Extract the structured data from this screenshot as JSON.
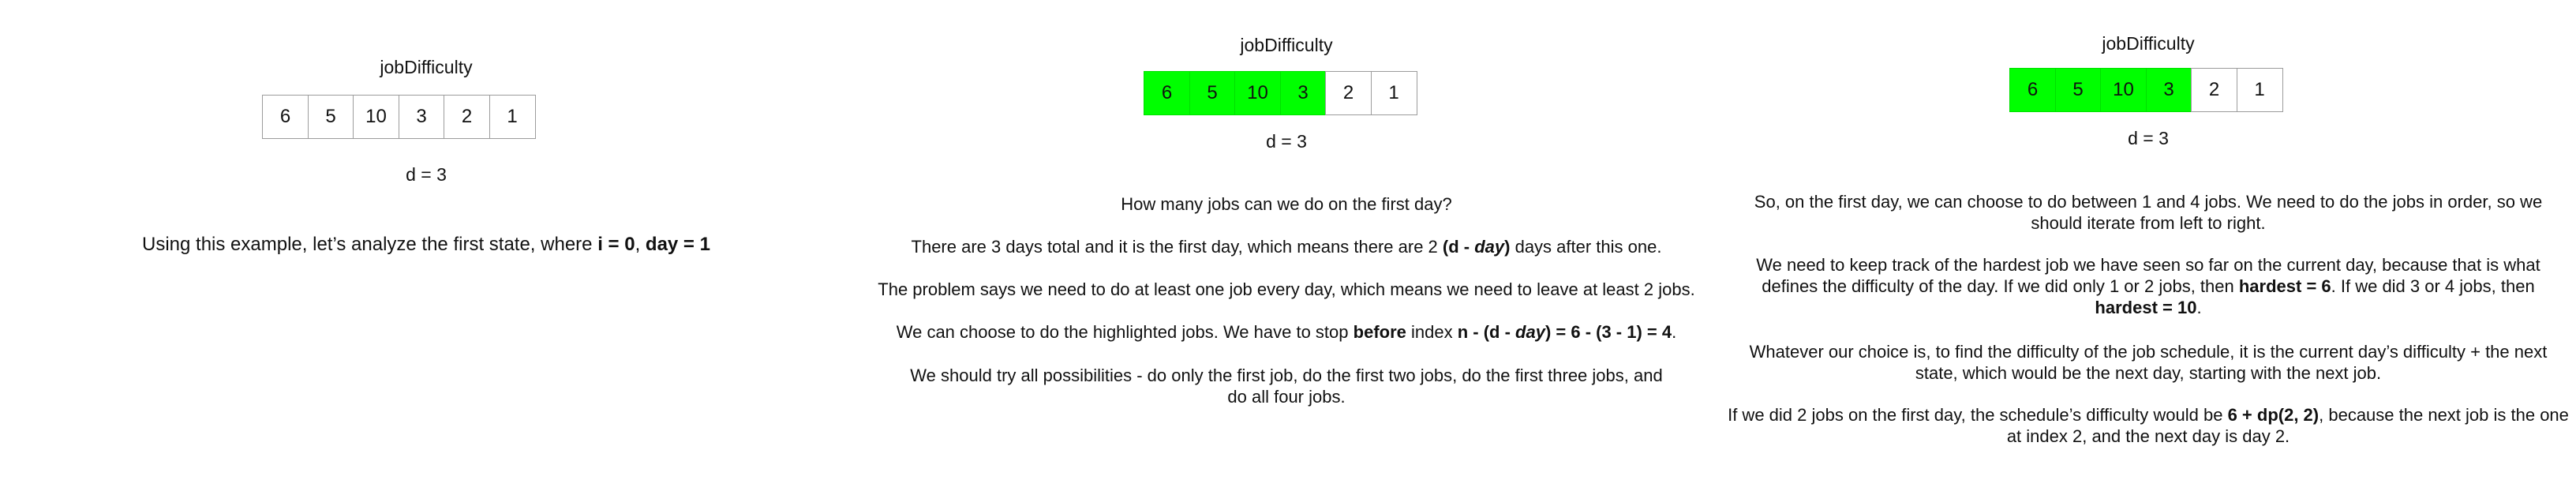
{
  "panel1": {
    "title": "jobDifficulty",
    "cells": [
      "6",
      "5",
      "10",
      "3",
      "2",
      "1"
    ],
    "d_label": "d = 3",
    "caption": {
      "pre": "Using this example, let’s analyze the first state, where ",
      "b1": "i = 0",
      "mid": ", ",
      "b2": "day = 1"
    }
  },
  "panel2": {
    "title": "jobDifficulty",
    "cells": [
      "6",
      "5",
      "10",
      "3",
      "2",
      "1"
    ],
    "highlighted_count": 4,
    "d_label": "d = 3",
    "q": "How many jobs can we do on the first day?",
    "p1": {
      "pre": "There are 3 days total and it is the first day, which means there are 2 ",
      "b_open": "(d - ",
      "b_i": "day",
      "b_close": ")",
      "post": " days after this one."
    },
    "p2": "The problem says we need to do at least one job every day, which means we need to leave at least 2 jobs.",
    "p3": {
      "pre": "We can choose to do the highlighted jobs. We have to stop ",
      "b1": "before",
      "mid": " index ",
      "b2_open": "n - (d - ",
      "b2_i": "day",
      "b2_close": ") = 6 - (3 - 1) = 4",
      "post": "."
    },
    "p4": "We should try all possibilities - do only the first job, do the first two jobs, do the first three jobs, and do all four jobs."
  },
  "panel3": {
    "title": "jobDifficulty",
    "cells": [
      "6",
      "5",
      "10",
      "3",
      "2",
      "1"
    ],
    "highlighted_count": 4,
    "d_label": "d = 3",
    "p1": "So, on the first day, we can choose to do between 1 and 4 jobs. We need to do the jobs in order, so we should iterate from left to right.",
    "p2": {
      "pre": "We need to keep track of the hardest job we have seen so far on the current day, because that is what defines the difficulty of the day. If we did only 1 or 2 jobs, then ",
      "b1": "hardest = 6",
      "mid": ". If we did 3 or 4 jobs, then ",
      "b2": "hardest = 10",
      "post": "."
    },
    "p3": "Whatever our choice is, to find the difficulty of the job schedule, it is the current day’s difficulty + the next state, which would be the next day, starting with the next job.",
    "p4": {
      "pre": "If we did 2 jobs on the first day, the schedule’s difficulty would be ",
      "b1": "6 + dp(2, 2)",
      "post": ", because the next job is the one at index 2, and the next day is day 2."
    }
  },
  "colors": {
    "highlight": "#00ff00",
    "cell_border": "#9c9c9c",
    "text": "#111111"
  }
}
